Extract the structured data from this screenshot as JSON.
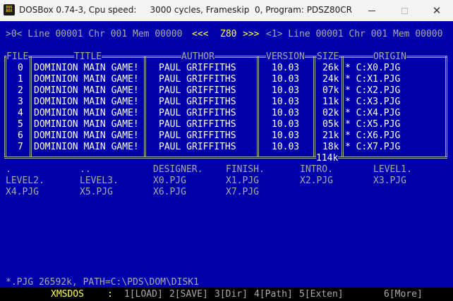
{
  "window": {
    "title": "DOSBox 0.74-3, Cpu speed:     3000 cycles, Frameskip  0, Program: PDSZ80CR",
    "icon_label_top": "DOS",
    "icon_label_bottom": "BOX",
    "minimize_icon": "minimize-icon",
    "maximize_icon": "maximize-icon",
    "close_glyph": "✕"
  },
  "status_line": {
    "left": ">0< Line 00001 Chr 001 Mem 00000",
    "arrows_left": "<<<",
    "center": "Z80",
    "arrows_right": ">>>",
    "right": "<1> Line 00001 Chr 001 Mem 00000"
  },
  "table": {
    "headers": {
      "file": "FILE",
      "title": "TITLE",
      "author": "AUTHOR",
      "version": "VERSION",
      "size": "SIZE",
      "origin": "ORIGIN"
    },
    "rows": [
      {
        "file": "0",
        "title": "DOMINION MAIN GAME!",
        "author": "PAUL GRIFFITHS",
        "version": "10.03",
        "size": "26k",
        "origin": "* C:X0.PJG"
      },
      {
        "file": "1",
        "title": "DOMINION MAIN GAME!",
        "author": "PAUL GRIFFITHS",
        "version": "10.03",
        "size": "24k",
        "origin": "* C:X1.PJG"
      },
      {
        "file": "2",
        "title": "DOMINION MAIN GAME!",
        "author": "PAUL GRIFFITHS",
        "version": "10.03",
        "size": "07k",
        "origin": "* C:X2.PJG"
      },
      {
        "file": "3",
        "title": "DOMINION MAIN GAME!",
        "author": "PAUL GRIFFITHS",
        "version": "10.03",
        "size": "11k",
        "origin": "* C:X3.PJG"
      },
      {
        "file": "4",
        "title": "DOMINION MAIN GAME!",
        "author": "PAUL GRIFFITHS",
        "version": "10.03",
        "size": "02k",
        "origin": "* C:X4.PJG"
      },
      {
        "file": "5",
        "title": "DOMINION MAIN GAME!",
        "author": "PAUL GRIFFITHS",
        "version": "10.03",
        "size": "05k",
        "origin": "* C:X5.PJG"
      },
      {
        "file": "6",
        "title": "DOMINION MAIN GAME!",
        "author": "PAUL GRIFFITHS",
        "version": "10.03",
        "size": "21k",
        "origin": "* C:X6.PJG"
      },
      {
        "file": "7",
        "title": "DOMINION MAIN GAME!",
        "author": "PAUL GRIFFITHS",
        "version": "10.03",
        "size": "18k",
        "origin": "* C:X7.PJG"
      }
    ],
    "total_size": "114k"
  },
  "directory": {
    "entries": [
      ".",
      "..",
      "DESIGNER.",
      "FINISH.",
      "INTRO.",
      "LEVEL1.",
      "LEVEL2.",
      "LEVEL3.",
      "X0.PJG",
      "X1.PJG",
      "X2.PJG",
      "X3.PJG",
      "X4.PJG",
      "X5.PJG",
      "X6.PJG",
      "X7.PJG"
    ]
  },
  "path_line": "*.PJG 26592k, PATH=C:\\PDS\\DOM\\DISK1",
  "menu": {
    "mode": "XMSDOS",
    "separator": ":",
    "items": [
      "1[LOAD]",
      "2[SAVE]",
      "3[Dir]",
      "4[Path]",
      "5[Exten]",
      "6[More]"
    ]
  }
}
